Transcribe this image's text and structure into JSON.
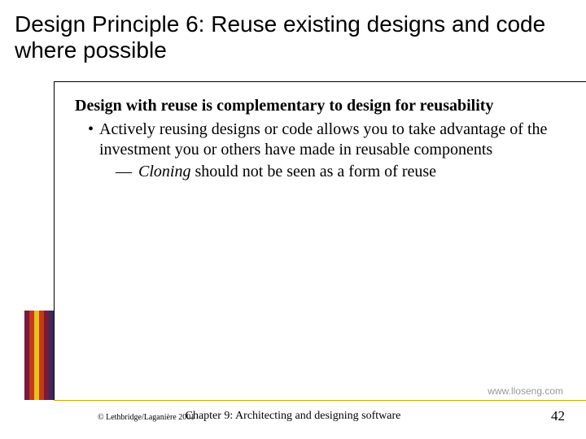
{
  "title": "Design Principle 6: Reuse existing designs and code where possible",
  "lead": "Design with reuse is complementary to design for reusability",
  "bullet1": "Actively reusing designs or code allows you to take advantage of the investment you or others have made in reusable components",
  "sub1_emph": "Cloning",
  "sub1_rest": " should not be seen as a form of reuse",
  "url": "www.lloseng.com",
  "copyright": "© Lethbridge/Laganière 2001",
  "chapter": "Chapter 9: Architecting and designing software",
  "page": "42"
}
